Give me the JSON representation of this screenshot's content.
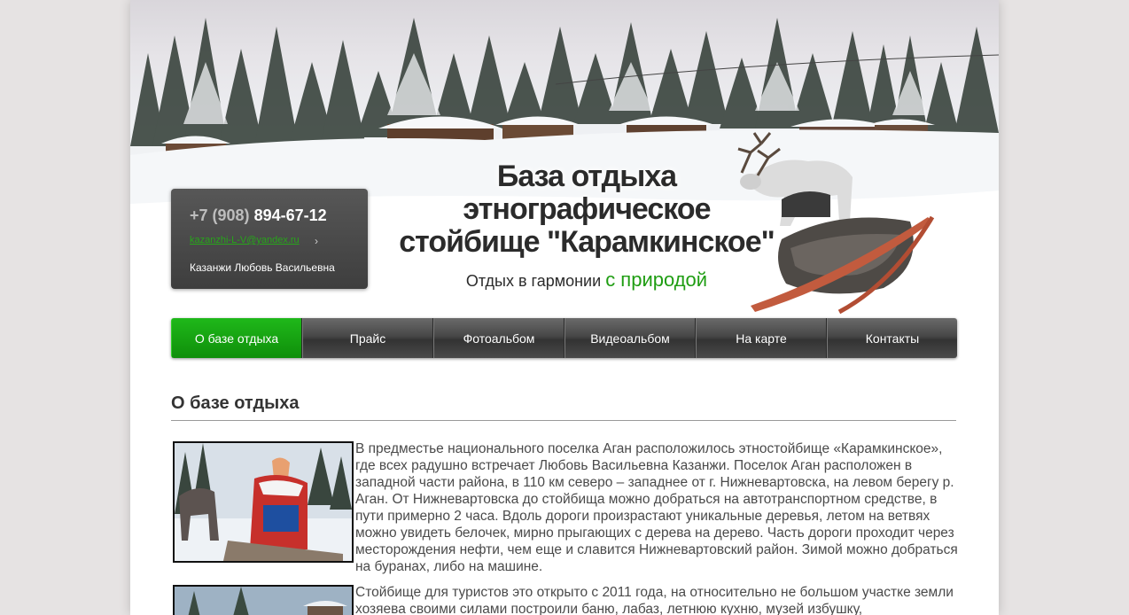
{
  "contacts": {
    "phone_code": "+7 (908)",
    "phone_number": "894-67-12",
    "email": "kazanzhi-L-V@yandex.ru",
    "email_arrow": "›",
    "owner": "Казанжи Любовь Васильевна"
  },
  "header": {
    "title_lines": [
      "База отдыха",
      "этнографическое",
      "стойбище \"Карамкинское\""
    ],
    "slogan_plain": "Отдых в гармонии",
    "slogan_accent": "с природой"
  },
  "nav": {
    "items": [
      "О базе отдыха",
      "Прайс",
      "Фотоальбом",
      "Видеоальбом",
      "На карте",
      "Контакты"
    ],
    "active_index": 0
  },
  "content": {
    "heading": "О базе отдыха",
    "paragraphs": [
      "В предместье национального поселка Аган расположилось этностойбище «Карамкинское», где всех радушно встречает Любовь Васильевна Казанжи. Поселок Аган расположен в западной части района, в 110 км северо – западнее от г. Нижневартовска, на левом берегу р. Аган. От Нижневартовска до стойбища можно добраться на автотранспортном средстве, в пути примерно 2 часа. Вдоль дороги произрастают уникальные деревья, летом на ветвях можно увидеть белочек, мирно прыгающих с дерева на дерево. Часть дороги проходит через месторождения нефти, чем еще и славится Нижневартовский район. Зимой можно добраться на буранах, либо на машине.",
      "Стойбище для туристов это открыто с 2011 года, на относительно не большом участке земли хозяева своими силами построили баню, лабаз, летнюю кухню, музей избушку,"
    ]
  },
  "colors": {
    "accent_green": "#1f9d12",
    "nav_active": "#12a00c",
    "nav_bg": "#444444",
    "page_bg": "#e6e3e3"
  },
  "icons": [
    "chevron-right-icon"
  ]
}
